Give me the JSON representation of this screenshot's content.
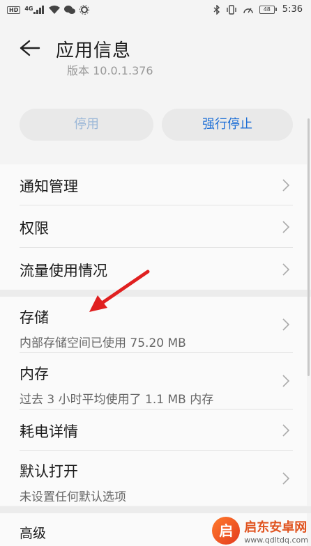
{
  "status_bar": {
    "left_icons": [
      "hd-icon",
      "4g-signal-icon",
      "wifi-icon",
      "wechat-icon",
      "settings-icon"
    ],
    "hd_label": "HD",
    "net_label": "4G",
    "battery_level": "48",
    "time": "5:36"
  },
  "header": {
    "title": "应用信息",
    "version_text": "版本 10.0.1.376"
  },
  "buttons": {
    "disable": "停用",
    "force_stop": "强行停止"
  },
  "menu": {
    "notifications": "通知管理",
    "permissions": "权限",
    "data_usage": "流量使用情况",
    "storage": {
      "title": "存储",
      "subtitle": "内部存储空间已使用 75.20 MB"
    },
    "memory": {
      "title": "内存",
      "subtitle": "过去 3 小时平均使用了 1.1 MB 内存"
    },
    "battery": "耗电详情",
    "default_open": {
      "title": "默认打开",
      "subtitle": "未设置任何默认选项"
    },
    "advanced": "高级"
  },
  "watermark": {
    "logo": "启",
    "name": "启东安卓网",
    "url": "www.qdltdq.com"
  },
  "colors": {
    "accent": "#1e6fd6",
    "disabled": "#9cb8d8",
    "arrow": "#e02020"
  }
}
